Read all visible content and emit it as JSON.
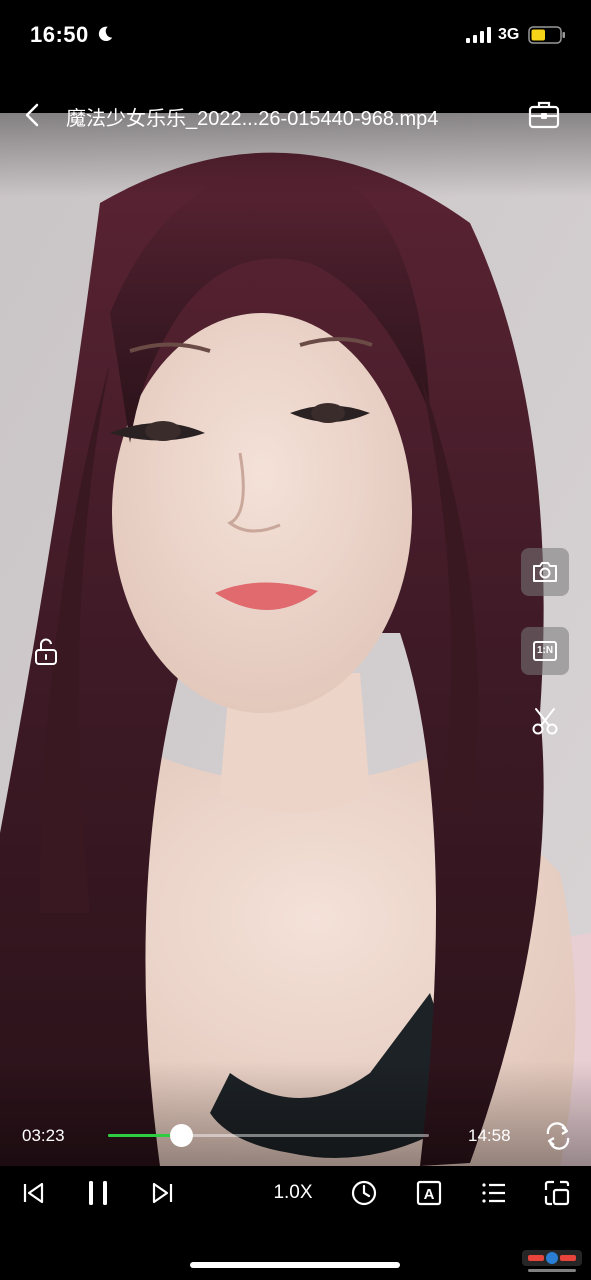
{
  "status_bar": {
    "time": "16:50",
    "network": "3G",
    "battery_level": 0.5,
    "battery_color": "#f7d417"
  },
  "header": {
    "title": "魔法少女乐乐_2022...26-015440-968.mp4",
    "back_icon": "chevron-left-icon",
    "toolbox_icon": "toolbox-icon"
  },
  "side_controls": {
    "lock_icon": "unlock-icon",
    "screenshot_icon": "camera-icon",
    "ratio_label": "1:N",
    "cut_icon": "scissors-icon"
  },
  "playback": {
    "current_time": "03:23",
    "total_time": "14:58",
    "progress": 0.226,
    "progress_color": "#2ecc40",
    "loop_icon": "loop-icon"
  },
  "controls": {
    "speed_label": "1.0X",
    "prev_icon": "skip-previous-icon",
    "pause_icon": "pause-icon",
    "next_icon": "skip-next-icon",
    "timer_icon": "clock-icon",
    "subtitle_icon": "subtitle-icon",
    "subtitle_glyph": "A",
    "playlist_icon": "playlist-icon",
    "pip_icon": "picture-in-picture-icon"
  }
}
